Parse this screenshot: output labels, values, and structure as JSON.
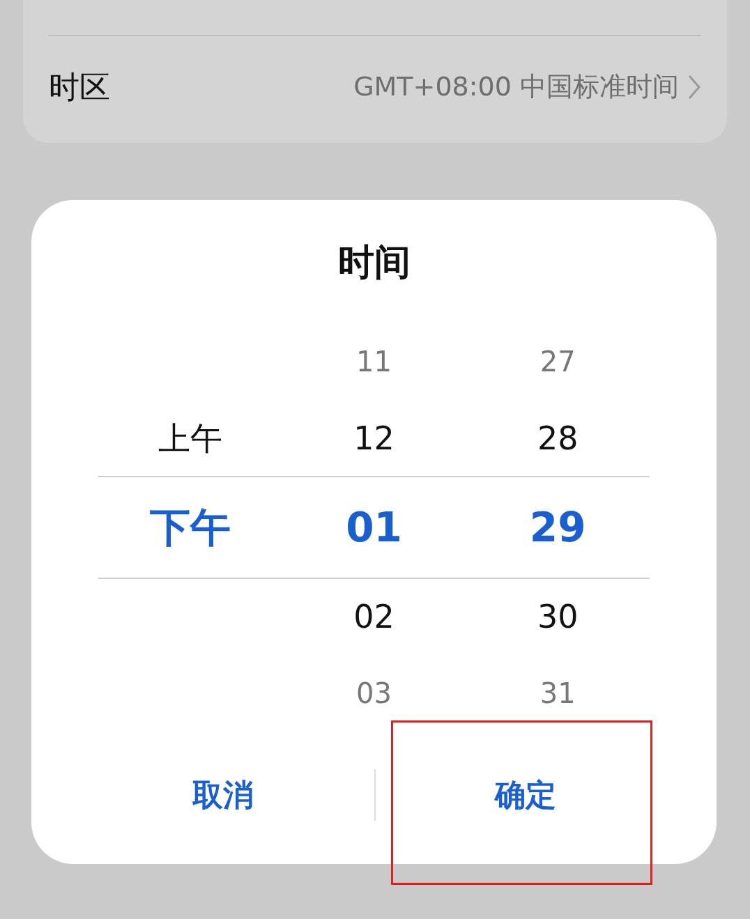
{
  "settings": {
    "rows": [
      {
        "label": "时区",
        "value": "GMT+08:00 中国标准时间"
      }
    ]
  },
  "dialog": {
    "title": "时间",
    "columns": [
      {
        "items": [
          {
            "text": "上午",
            "selected": false
          },
          {
            "text": "下午",
            "selected": true
          }
        ]
      },
      {
        "items": [
          {
            "text": "11",
            "selected": false
          },
          {
            "text": "12",
            "selected": false
          },
          {
            "text": "01",
            "selected": true
          },
          {
            "text": "02",
            "selected": false
          },
          {
            "text": "03",
            "selected": false
          }
        ]
      },
      {
        "items": [
          {
            "text": "27",
            "selected": false
          },
          {
            "text": "28",
            "selected": false
          },
          {
            "text": "29",
            "selected": true
          },
          {
            "text": "30",
            "selected": false
          },
          {
            "text": "31",
            "selected": false
          }
        ]
      }
    ],
    "buttons": [
      {
        "label": "取消",
        "highlighted": false
      },
      {
        "label": "确定",
        "highlighted": true
      }
    ]
  }
}
